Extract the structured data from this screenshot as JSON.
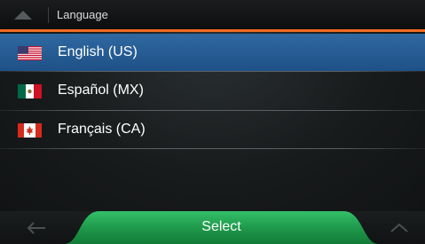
{
  "header": {
    "title": "Language"
  },
  "languages": [
    {
      "label": "English (US)",
      "flag": "us-flag",
      "selected": true
    },
    {
      "label": "Español (MX)",
      "flag": "mexico-flag",
      "selected": false
    },
    {
      "label": "Français (CA)",
      "flag": "canada-flag",
      "selected": false
    }
  ],
  "footer": {
    "select_label": "Select"
  },
  "colors": {
    "accent": "#f06b23",
    "selected_row": "#2f68a1",
    "select_button": "#1e9a4a"
  }
}
